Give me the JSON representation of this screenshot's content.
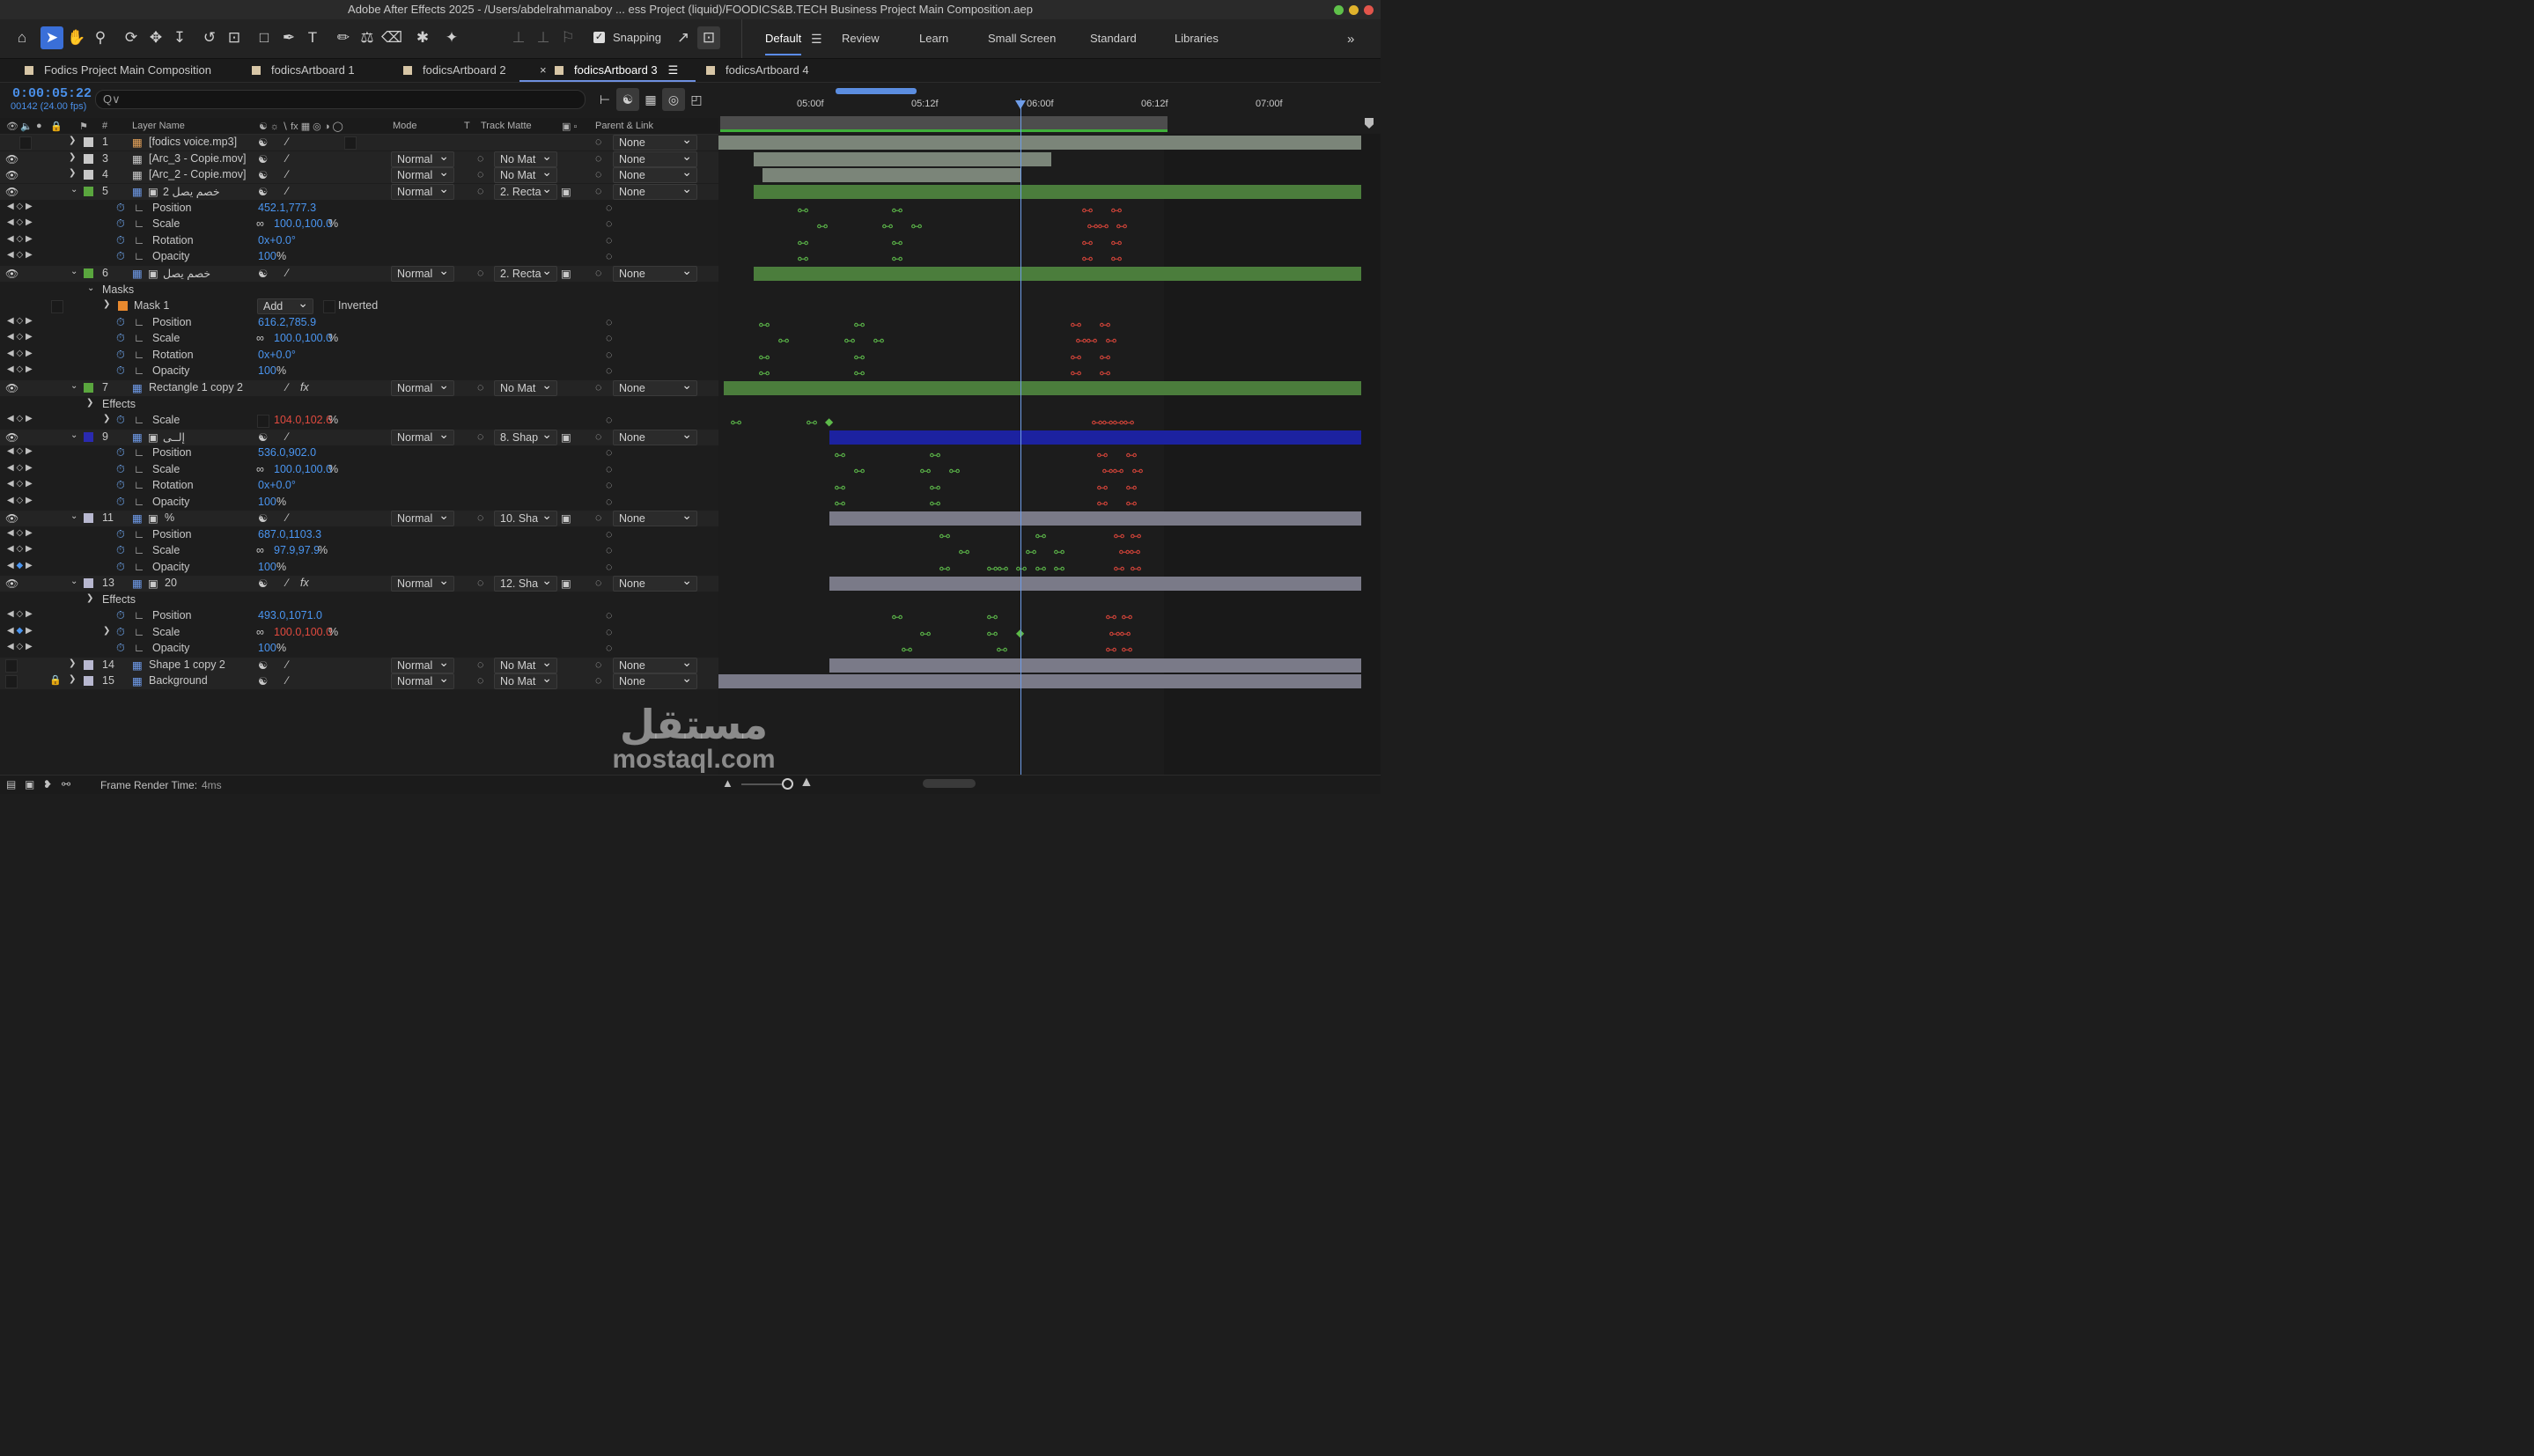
{
  "window": {
    "title": "Adobe After Effects 2025 - /Users/abdelrahmanaboy ... ess Project (liquid)/FOODICS&B.TECH Business Project Main Composition.aep"
  },
  "toolbar": {
    "snapping_label": "Snapping",
    "workspaces": [
      "Default",
      "Review",
      "Learn",
      "Small Screen",
      "Standard",
      "Libraries"
    ]
  },
  "tabs": [
    "Fodics Project Main Composition",
    "fodicsArtboard 1",
    "fodicsArtboard 2",
    "fodicsArtboard 3",
    "fodicsArtboard 4"
  ],
  "time": {
    "timecode": "0:00:05:22",
    "frames": "00142 (24.00 fps)"
  },
  "search": {
    "placeholder": "Q∨"
  },
  "columns": {
    "num": "#",
    "layer_name": "Layer Name",
    "mode": "Mode",
    "t": "T",
    "track_matte": "Track Matte",
    "parent": "Parent & Link"
  },
  "layers": {
    "l1": {
      "num": "1",
      "name": "[fodics voice.mp3]",
      "parent": "None"
    },
    "l3": {
      "num": "3",
      "name": "[Arc_3 - Copie.mov]",
      "mode": "Normal",
      "matte": "No Mat",
      "parent": "None"
    },
    "l4": {
      "num": "4",
      "name": "[Arc_2 - Copie.mov]",
      "mode": "Normal",
      "matte": "No Mat",
      "parent": "None"
    },
    "l5": {
      "num": "5",
      "name": "2 خصم يصل",
      "mode": "Normal",
      "matte": "2. Recta",
      "parent": "None"
    },
    "l6": {
      "num": "6",
      "name": "خصم يصل",
      "mode": "Normal",
      "matte": "2. Recta",
      "parent": "None"
    },
    "l7": {
      "num": "7",
      "name": "Rectangle 1 copy 2",
      "mode": "Normal",
      "matte": "No Mat",
      "parent": "None"
    },
    "l9": {
      "num": "9",
      "name": "إلــى",
      "mode": "Normal",
      "matte": "8. Shap",
      "parent": "None"
    },
    "l11": {
      "num": "11",
      "name": "%",
      "mode": "Normal",
      "matte": "10. Sha",
      "parent": "None"
    },
    "l13": {
      "num": "13",
      "name": "20",
      "mode": "Normal",
      "matte": "12. Sha",
      "parent": "None"
    },
    "l14": {
      "num": "14",
      "name": "Shape 1 copy 2",
      "mode": "Normal",
      "matte": "No Mat",
      "parent": "None"
    },
    "l15": {
      "num": "15",
      "name": "Background",
      "mode": "Normal",
      "matte": "No Mat",
      "parent": "None"
    }
  },
  "props": {
    "position": "Position",
    "scale": "Scale",
    "rotation": "Rotation",
    "opacity": "Opacity",
    "masks": "Masks",
    "mask1": "Mask 1",
    "mask_mode": "Add",
    "inverted": "Inverted",
    "effects": "Effects",
    "l5_pos": "452.1,777.3",
    "l5_scale": "100.0,100.0",
    "l5_rot": "0x+0.0°",
    "l5_op": "100",
    "l6_pos": "616.2,785.9",
    "l6_scale": "100.0,100.0",
    "l6_rot": "0x+0.0°",
    "l6_op": "100",
    "l7_scale": "104.0,102.6",
    "l9_pos": "536.0,902.0",
    "l9_scale": "100.0,100.0",
    "l9_rot": "0x+0.0°",
    "l9_op": "100",
    "l11_pos": "687.0,1103.3",
    "l11_scale": "97.9,97.9",
    "l11_op": "100",
    "l13_pos": "493.0,1071.0",
    "l13_scale": "100.0,100.0",
    "l13_op": "100",
    "pct": "%"
  },
  "ruler": {
    "ticks": [
      "05:00f",
      "05:12f",
      "06:00f",
      "06:12f",
      "07:00f"
    ]
  },
  "status": {
    "label": "Frame Render Time:",
    "value": "4ms"
  },
  "watermark": {
    "line1": "مستقل",
    "line2": "mostaql.com"
  },
  "colors": {
    "accent": "#4a8fe8",
    "layer_green": "#4b7d3c",
    "layer_blue": "#1c22a0",
    "layer_gray": "#7a7a88",
    "kf_green": "#5dba4a",
    "kf_red": "#d8453a"
  }
}
